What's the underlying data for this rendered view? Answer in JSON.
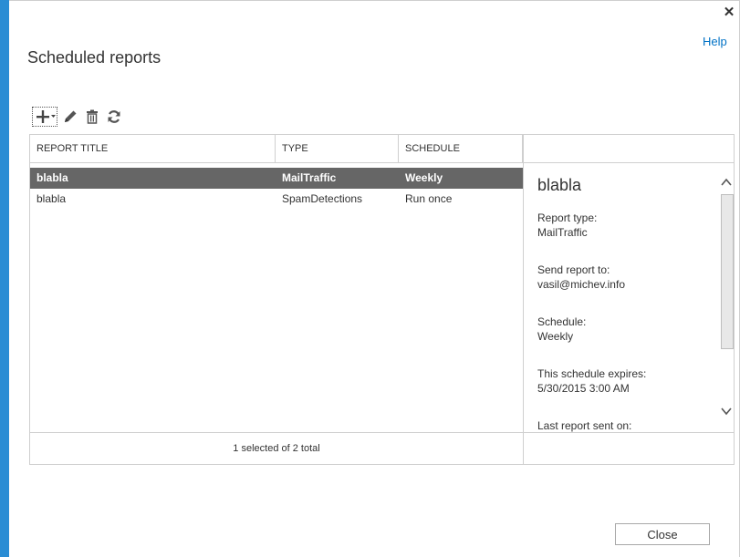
{
  "window": {
    "close_glyph": "✕",
    "help_label": "Help"
  },
  "page": {
    "title": "Scheduled reports"
  },
  "toolbar": {
    "items": [
      {
        "name": "add-icon",
        "label": ""
      },
      {
        "name": "edit-icon",
        "label": ""
      },
      {
        "name": "delete-icon",
        "label": ""
      },
      {
        "name": "refresh-icon",
        "label": ""
      }
    ]
  },
  "table": {
    "columns": [
      "REPORT TITLE",
      "TYPE",
      "SCHEDULE"
    ],
    "rows": [
      {
        "title": "blabla",
        "type": "MailTraffic",
        "schedule": "Weekly",
        "selected": true
      },
      {
        "title": "blabla",
        "type": "SpamDetections",
        "schedule": "Run once",
        "selected": false
      }
    ],
    "status": "1 selected of 2 total"
  },
  "details": {
    "title": "blabla",
    "fields": [
      {
        "label": "Report type:",
        "value": "MailTraffic"
      },
      {
        "label": "Send report to:",
        "value": "vasil@michev.info"
      },
      {
        "label": "Schedule:",
        "value": "Weekly"
      },
      {
        "label": "This schedule expires:",
        "value": "5/30/2015 3:00 AM"
      },
      {
        "label": "Last report sent on:",
        "value": ""
      }
    ]
  },
  "footer": {
    "close_label": "Close"
  },
  "colors": {
    "accent_bar": "#2a8dd4",
    "link": "#0072c6",
    "selected_row": "#666666"
  }
}
